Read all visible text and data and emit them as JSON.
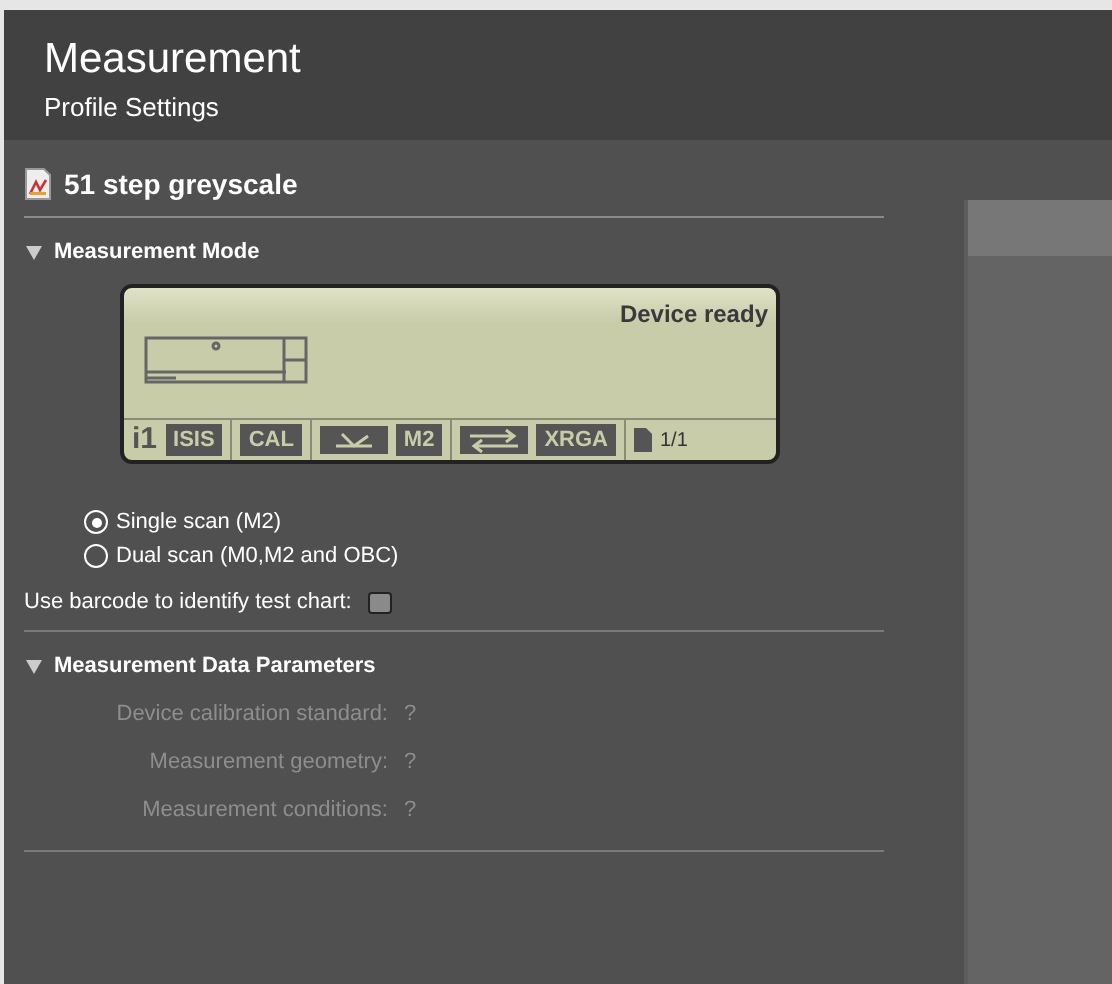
{
  "header": {
    "title": "Measurement",
    "subtitle": "Profile Settings"
  },
  "document": {
    "title": "51 step greyscale"
  },
  "measurement_mode": {
    "title": "Measurement Mode",
    "expanded": true,
    "display": {
      "status": "Device ready",
      "groups": [
        [
          {
            "kind": "logo",
            "text": "i1"
          },
          {
            "kind": "label",
            "text": "ISIS"
          }
        ],
        [
          {
            "kind": "label",
            "text": "CAL"
          }
        ],
        [
          {
            "kind": "scan"
          },
          {
            "kind": "label",
            "text": "M2"
          }
        ],
        [
          {
            "kind": "swap"
          },
          {
            "kind": "label",
            "text": "XRGA"
          }
        ],
        [
          {
            "kind": "page",
            "text": "1/1"
          }
        ]
      ]
    },
    "scan_options": [
      {
        "label": "Single scan (M2)",
        "selected": true
      },
      {
        "label": "Dual scan (M0,M2 and OBC)",
        "selected": false
      }
    ],
    "barcode": {
      "label": "Use barcode to identify test chart:",
      "checked": false
    }
  },
  "data_parameters": {
    "title": "Measurement Data Parameters",
    "expanded": true,
    "rows": [
      {
        "label": "Device calibration standard:",
        "value": "?",
        "disabled": true
      },
      {
        "label": "Measurement geometry:",
        "value": "?",
        "disabled": true
      },
      {
        "label": "Measurement conditions:",
        "value": "?",
        "disabled": true
      }
    ]
  }
}
